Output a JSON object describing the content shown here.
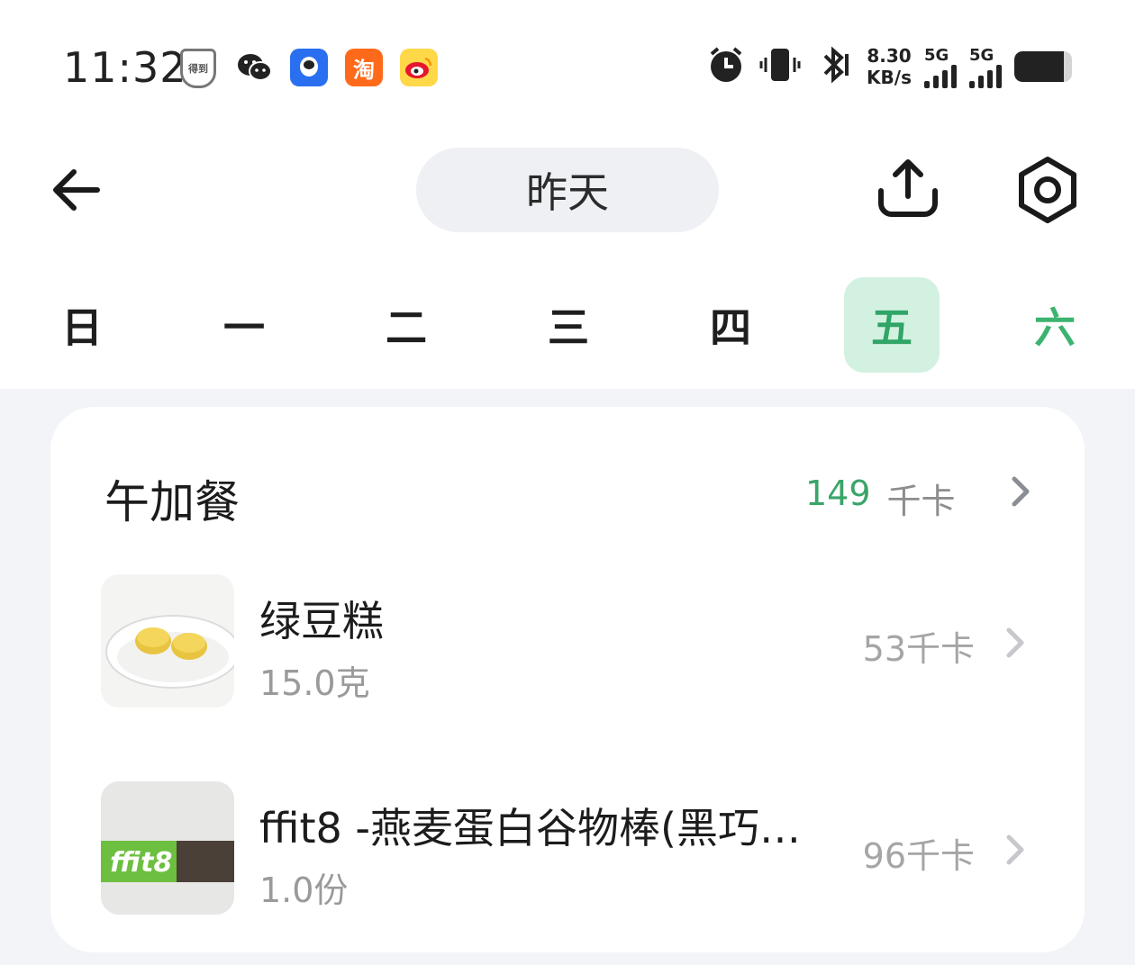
{
  "status_bar": {
    "time": "11:32",
    "app_icons": [
      "shield-icon",
      "wechat-icon",
      "qq-icon",
      "taobao-icon",
      "weibo-icon"
    ],
    "taobao_glyph": "淘",
    "shield_glyph": "得到",
    "net_speed_value": "8.30",
    "net_speed_unit": "KB/s",
    "sim1_label": "5G",
    "sim2_label": "5G",
    "battery_level": 0.86
  },
  "header": {
    "date_label": "昨天"
  },
  "week": {
    "days": [
      "日",
      "一",
      "二",
      "三",
      "四",
      "五",
      "六"
    ],
    "selected_index": 5
  },
  "meal": {
    "title": "午加餐",
    "kcal_value": "149",
    "kcal_unit": "千卡",
    "items": [
      {
        "name": "绿豆糕",
        "amount": "15.0克",
        "kcal": "53千卡",
        "thumb": "mung-bean-cake"
      },
      {
        "name": "ffit8 -燕麦蛋白谷物棒(黑巧…",
        "amount": "1.0份",
        "kcal": "96千卡",
        "thumb": "ffit8-bar",
        "thumb_text": "ffit8"
      }
    ]
  },
  "colors": {
    "accent_green": "#3aa56a",
    "selected_day_bg": "#d3f1e1",
    "page_bg": "#f3f4f8"
  }
}
